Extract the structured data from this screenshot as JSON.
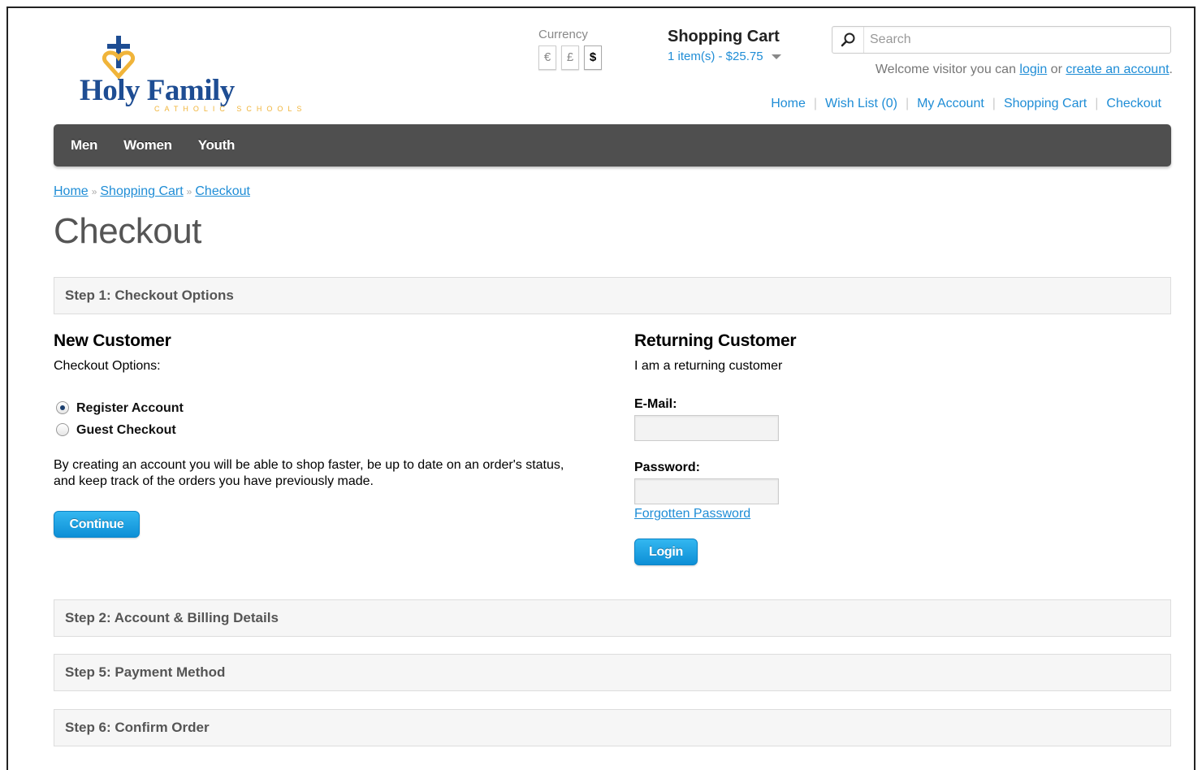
{
  "logo": {
    "title": "Holy Family",
    "subtitle": "CATHOLIC SCHOOLS"
  },
  "currency": {
    "label": "Currency",
    "options": [
      "€",
      "£",
      "$"
    ],
    "selected": "$"
  },
  "cart": {
    "title": "Shopping Cart",
    "summary": "1 item(s) - $25.75"
  },
  "search": {
    "placeholder": "Search"
  },
  "welcome": {
    "prefix": "Welcome visitor you can ",
    "login": "login",
    "middle": " or ",
    "create": "create an account",
    "suffix": "."
  },
  "top_links": [
    "Home",
    "Wish List (0)",
    "My Account",
    "Shopping Cart",
    "Checkout"
  ],
  "nav": [
    "Men",
    "Women",
    "Youth"
  ],
  "breadcrumb": [
    "Home",
    "Shopping Cart",
    "Checkout"
  ],
  "page_title": "Checkout",
  "steps": {
    "step1": "Step 1: Checkout Options",
    "step2": "Step 2: Account & Billing Details",
    "step5": "Step 5: Payment Method",
    "step6": "Step 6: Confirm Order"
  },
  "new_customer": {
    "heading": "New Customer",
    "options_label": "Checkout Options:",
    "radio_register": "Register Account",
    "radio_guest": "Guest Checkout",
    "selected": "Register Account",
    "description": "By creating an account you will be able to shop faster, be up to date on an order's status, and keep track of the orders you have previously made.",
    "continue_button": "Continue"
  },
  "returning_customer": {
    "heading": "Returning Customer",
    "subtext": "I am a returning customer",
    "email_label": "E-Mail:",
    "email_value": "",
    "password_label": "Password:",
    "password_value": "",
    "forgot_link": "Forgotten Password",
    "login_button": "Login"
  },
  "colors": {
    "link": "#1f8dd6",
    "nav_bg": "#4f4f4f",
    "button": "#1a9fe3",
    "logo_blue": "#1e4d93",
    "logo_gold": "#f0b43a"
  },
  "icons": {
    "search": "search-icon",
    "cart_dropdown": "chevron-down-icon",
    "logo_cross": "cross-heart-icon"
  }
}
